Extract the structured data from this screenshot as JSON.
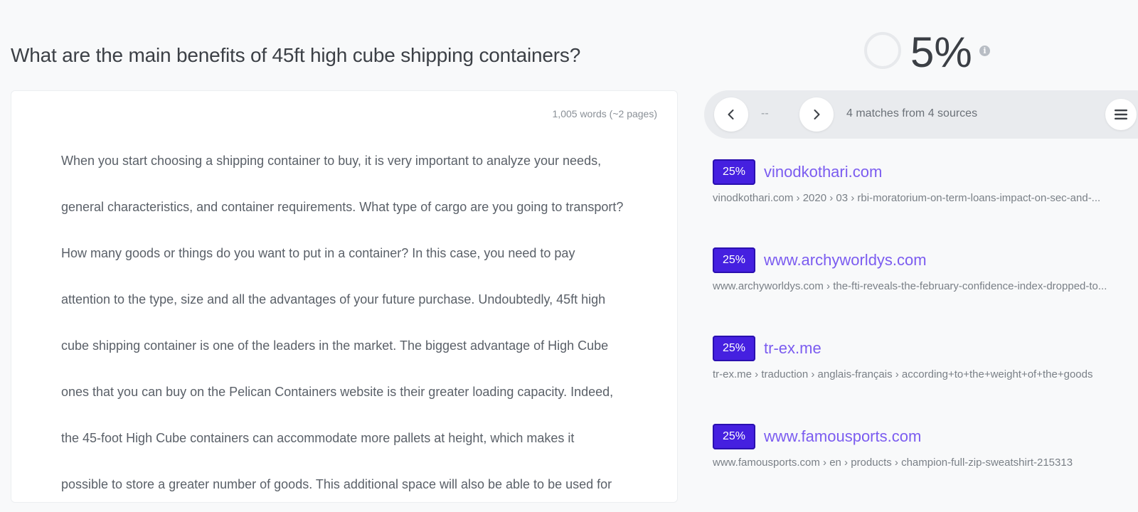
{
  "page": {
    "title": "What are the main benefits of 45ft high cube shipping containers?"
  },
  "document": {
    "word_count": "1,005 words (~2 pages)",
    "lines": [
      "When you start choosing a shipping container to buy, it is very important to analyze your needs,",
      "general characteristics, and container requirements. What type of cargo are you going to transport?",
      "How many goods or things do you want to put in a container? In this case, you need to pay",
      "attention to the type, size and all the advantages of your future purchase. Undoubtedly, 45ft high",
      "cube shipping container is one of the leaders in the market. The biggest advantage of High Cube",
      "ones that you can buy on the Pelican Containers website is their greater loading capacity. Indeed,",
      "the 45-foot High Cube containers can accommodate more pallets at height, which makes it",
      "possible to store a greater number of goods. This additional space will also be able to be used for"
    ]
  },
  "score": {
    "value": "5%",
    "percent": 5,
    "info_icon": "info-icon"
  },
  "results_bar": {
    "match_index": "--",
    "summary": "4 matches from 4 sources",
    "prev_icon": "chevron-left-icon",
    "next_icon": "chevron-right-icon",
    "menu_icon": "hamburger-menu-icon"
  },
  "sources": [
    {
      "percent": "25%",
      "domain": "vinodkothari.com",
      "path": "vinodkothari.com › 2020 › 03 › rbi-moratorium-on-term-loans-impact-on-sec-and-..."
    },
    {
      "percent": "25%",
      "domain": "www.archyworldys.com",
      "path": "www.archyworldys.com › the-fti-reveals-the-february-confidence-index-dropped-to..."
    },
    {
      "percent": "25%",
      "domain": "tr-ex.me",
      "path": "tr-ex.me › traduction › anglais-français › according+to+the+weight+of+the+goods"
    },
    {
      "percent": "25%",
      "domain": "www.famousports.com",
      "path": "www.famousports.com › en › products › champion-full-zip-sweatshirt-215313"
    }
  ],
  "colors": {
    "badge": "#4520e0",
    "link": "#7b5cf0",
    "background": "#f8f9fa"
  }
}
